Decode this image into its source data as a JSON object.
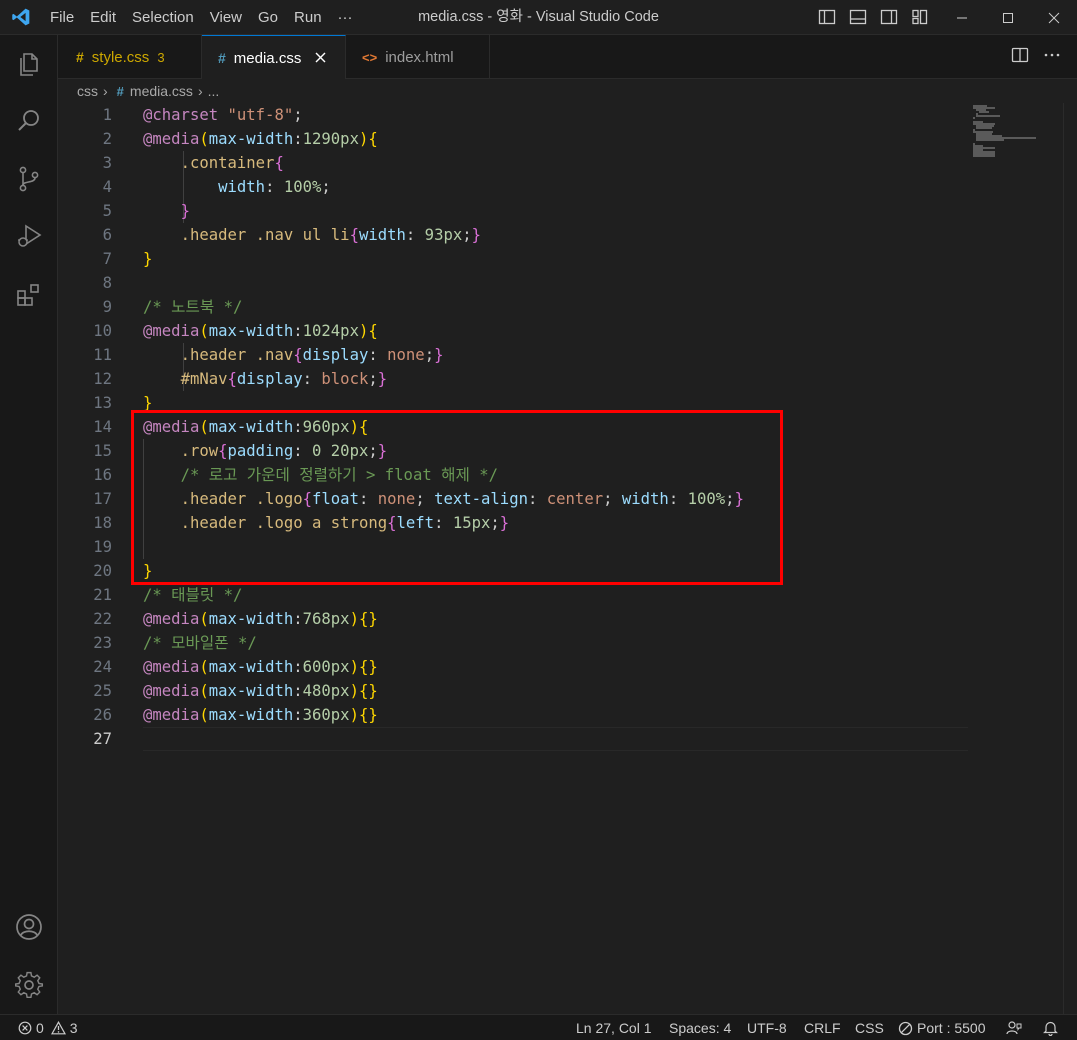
{
  "titlebar": {
    "menu": [
      "File",
      "Edit",
      "Selection",
      "View",
      "Go",
      "Run",
      "···"
    ],
    "title": "media.css - 영화 - Visual Studio Code"
  },
  "tabs": [
    {
      "label": "style.css",
      "badge": "3",
      "icon": "css-hash-icon",
      "active": false
    },
    {
      "label": "media.css",
      "icon": "css-hash-icon",
      "active": true
    },
    {
      "label": "index.html",
      "icon": "html-icon",
      "active": false
    }
  ],
  "breadcrumb": {
    "folder": "css",
    "file": "media.css",
    "more": "..."
  },
  "editor": {
    "line_numbers": [
      "1",
      "2",
      "3",
      "4",
      "5",
      "6",
      "7",
      "8",
      "9",
      "10",
      "11",
      "12",
      "13",
      "14",
      "15",
      "16",
      "17",
      "18",
      "19",
      "20",
      "21",
      "22",
      "23",
      "24",
      "25",
      "26",
      "27"
    ],
    "current_line": "27",
    "tokens": {
      "charset": "@charset",
      "charset_value": "\"utf-8\"",
      "semi": ";",
      "media": "@media",
      "open_paren": "(",
      "close_paren": ")",
      "open_brace": "{",
      "close_brace": "}",
      "empty_braces": "{}",
      "max_width": "max-width",
      "colon": ":",
      "w1290": "1290px",
      "w1024": "1024px",
      "w960": "960px",
      "w768": "768px",
      "w600": "600px",
      "w480": "480px",
      "w360": "360px",
      "container": ".container",
      "width": "width",
      "width_val": " 100%",
      "header": ".header",
      "nav_ul_li": " .nav ul li",
      "nav": " .nav",
      "nav_width_val": " 93px",
      "display": "display",
      "none": " none",
      "mnav": "#mNav",
      "block": " block",
      "row": ".row",
      "padding": "padding",
      "padding_val": " 0 20px",
      "comment_notebook": "/* 노트북 */",
      "comment_logo": "/* 로고 가운데 정렬하기 > float 해제 */",
      "comment_tablet": "/* 태블릿 */",
      "comment_mobile": "/* 모바일폰 */",
      "logo": " .logo",
      "float": "float",
      "text_align": " text-align",
      "center": " center",
      "width_sp": " width",
      "width_100": " 100%",
      "logo_a_strong": " .logo a strong",
      "left": "left",
      "left_val": " 15px"
    }
  },
  "statusbar": {
    "errors": "0",
    "warnings": "3",
    "position": "Ln 27, Col 1",
    "spaces": "Spaces: 4",
    "encoding": "UTF-8",
    "eol": "CRLF",
    "language": "CSS",
    "port": "Port : 5500"
  },
  "colors": {
    "accent": "#0078d4",
    "highlight_box": "#ff0000",
    "background": "#1f1f1f"
  }
}
